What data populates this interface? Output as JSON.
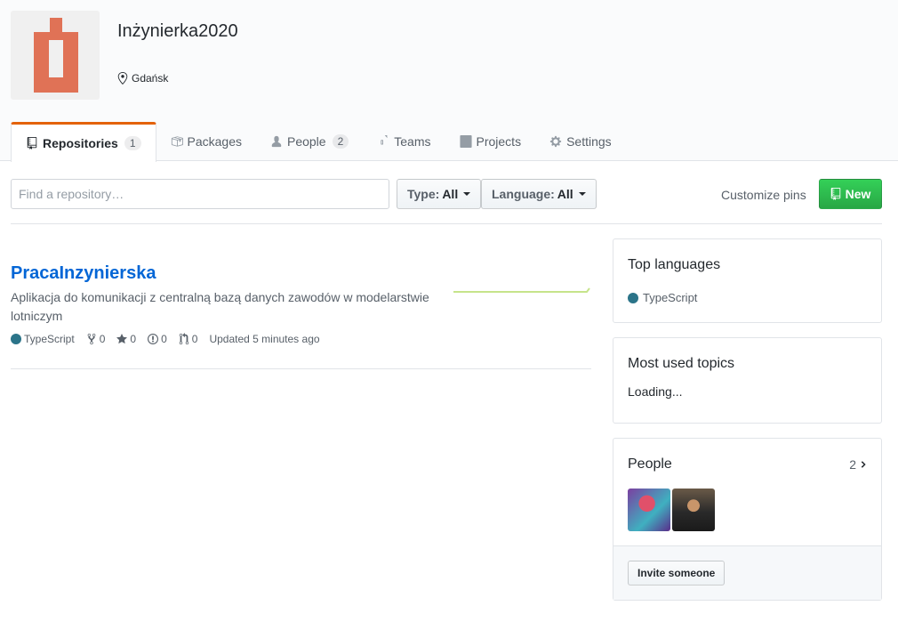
{
  "org": {
    "name": "Inżynierka2020",
    "location": "Gdańsk",
    "avatar_color": "#e07256"
  },
  "tabs": [
    {
      "label": "Repositories",
      "count": "1",
      "icon": "repo-icon",
      "selected": true
    },
    {
      "label": "Packages",
      "icon": "package-icon"
    },
    {
      "label": "People",
      "count": "2",
      "icon": "person-icon"
    },
    {
      "label": "Teams",
      "icon": "jersey-icon"
    },
    {
      "label": "Projects",
      "icon": "project-icon"
    },
    {
      "label": "Settings",
      "icon": "gear-icon"
    }
  ],
  "accent_color": "#e36209",
  "filters": {
    "search_placeholder": "Find a repository…",
    "type_label": "Type:",
    "type_value": "All",
    "language_label": "Language:",
    "language_value": "All",
    "customize_pins": "Customize pins",
    "new_button": "New"
  },
  "repo": {
    "name": "PracaInzynierska",
    "description": "Aplikacja do komunikacji z centralną bazą danych zawodów w modelarstwie lotniczym",
    "language": "TypeScript",
    "language_color": "#2b7489",
    "forks": "0",
    "stars": "0",
    "issues": "0",
    "pull_requests": "0",
    "updated": "Updated 5 minutes ago"
  },
  "sidebar": {
    "top_languages": {
      "title": "Top languages",
      "language": "TypeScript",
      "color": "#2b7489"
    },
    "topics": {
      "title": "Most used topics",
      "status": "Loading..."
    },
    "people": {
      "title": "People",
      "count": "2",
      "invite_button": "Invite someone"
    }
  }
}
